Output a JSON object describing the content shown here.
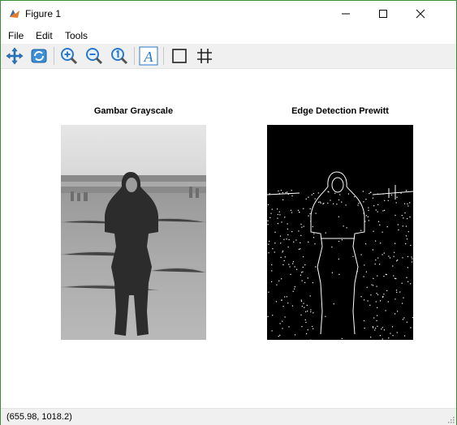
{
  "window": {
    "title": "Figure 1"
  },
  "menu": {
    "file": "File",
    "edit": "Edit",
    "tools": "Tools"
  },
  "toolbar": {
    "icons": [
      "pan-icon",
      "rotate-icon",
      "zoom-in-icon",
      "zoom-out-icon",
      "zoom-reset-icon",
      "text-tool-icon",
      "rectangle-icon",
      "grid-icon"
    ]
  },
  "axes": {
    "left_title": "Gambar Grayscale",
    "right_title": "Edge Detection Prewitt"
  },
  "status": {
    "coords": "(655.98, 1018.2)"
  },
  "colors": {
    "window_border": "#3c8a3c",
    "toolbar_bg": "#f0f0f0",
    "accent_blue": "#1f6fbf"
  }
}
